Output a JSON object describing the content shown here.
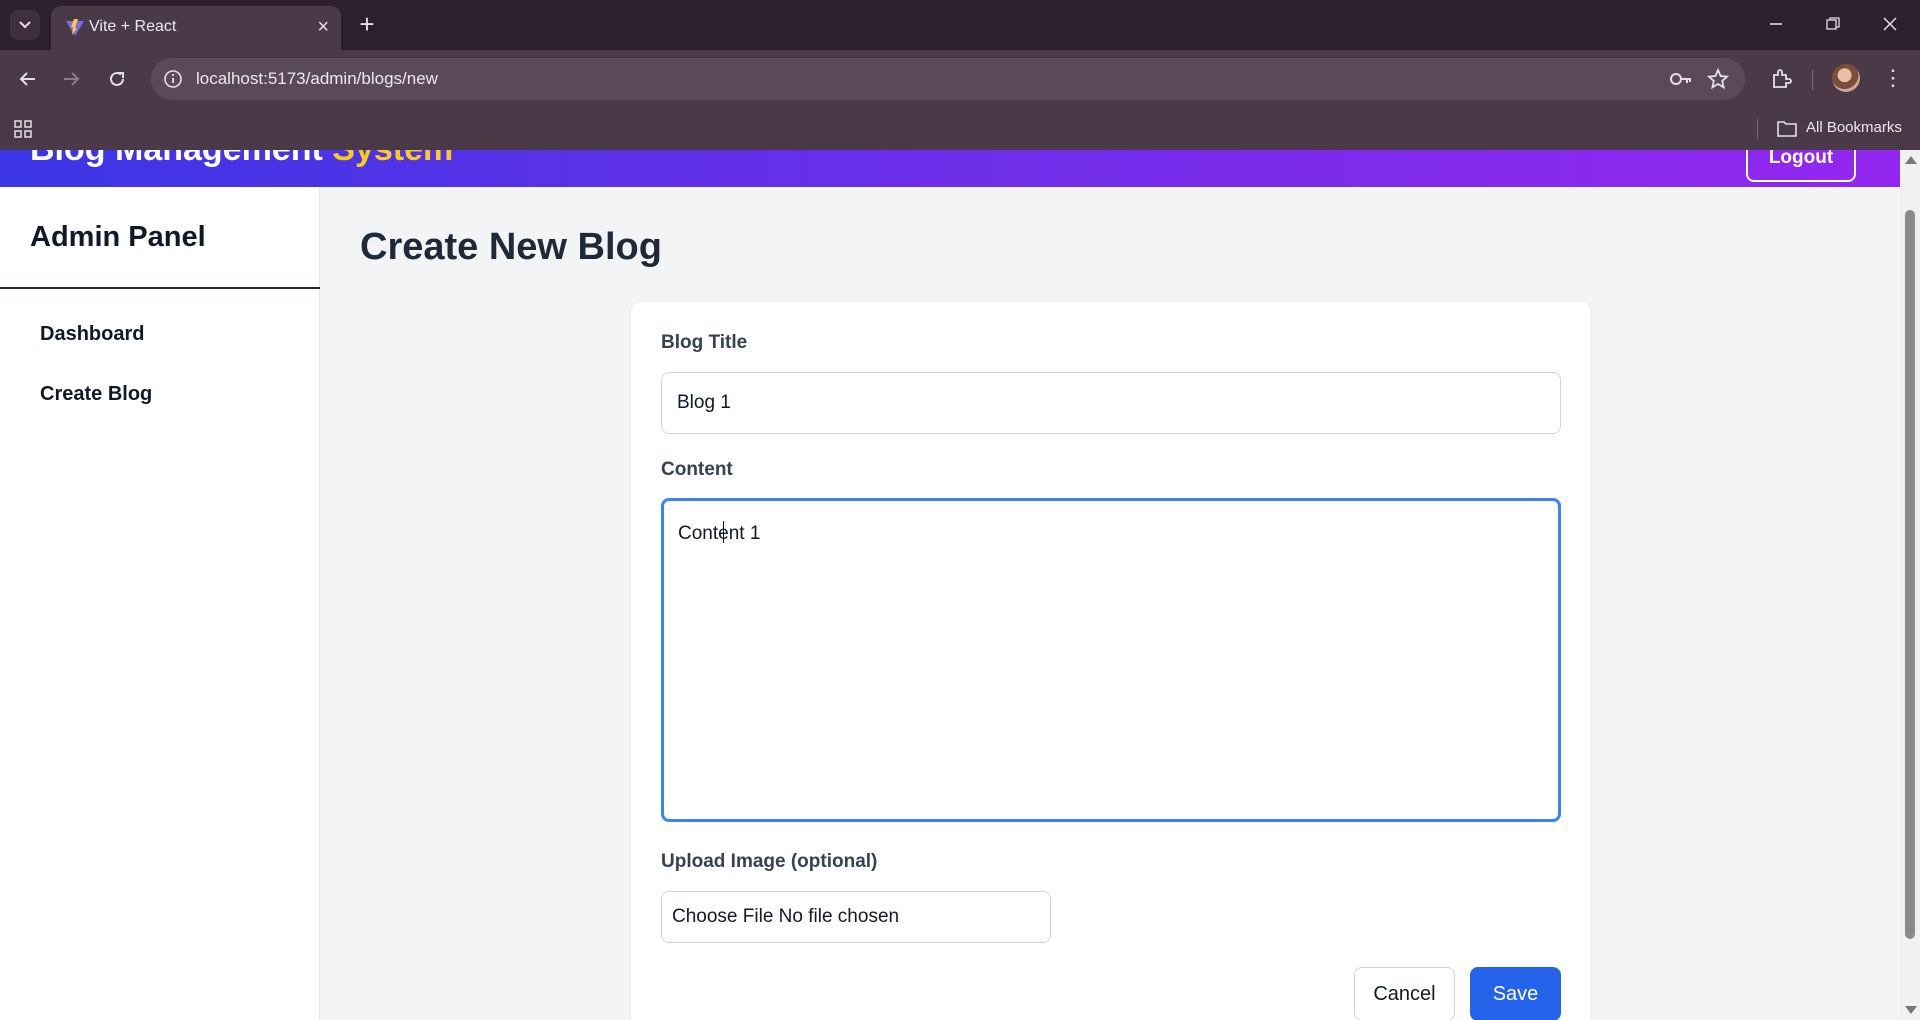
{
  "browser": {
    "tab_title": "Vite + React",
    "url": "localhost:5173/admin/blogs/new",
    "bookmarks_label": "All Bookmarks",
    "icons": [
      "tab-search-icon",
      "vite-favicon-icon",
      "close-icon",
      "new-tab-icon",
      "minimize-icon",
      "restore-icon",
      "close-window-icon",
      "back-icon",
      "forward-icon",
      "reload-icon",
      "site-info-icon",
      "password-key-icon",
      "bookmark-star-icon",
      "extensions-icon",
      "profile-avatar",
      "menu-icon",
      "apps-icon",
      "folder-icon"
    ]
  },
  "header": {
    "brand_main": "Blog Management",
    "brand_accent": "System",
    "logout_label": "Logout",
    "brand_accent_color": "#facc15"
  },
  "sidebar": {
    "title": "Admin Panel",
    "items": [
      {
        "label": "Dashboard"
      },
      {
        "label": "Create Blog"
      }
    ]
  },
  "main": {
    "title": "Create New Blog",
    "form": {
      "title_label": "Blog Title",
      "title_value": "Blog 1",
      "content_label": "Content",
      "content_before_caret": "Conte",
      "content_after_caret": "nt 1",
      "image_label": "Upload Image (optional)",
      "file_button": "Choose File",
      "file_status": "No file chosen",
      "cancel_label": "Cancel",
      "save_label": "Save"
    }
  },
  "colors": {
    "primary": "#2563eb",
    "focus_ring": "#3b82f6",
    "header_gradient_start": "#3b36e6",
    "header_gradient_end": "#9327f0"
  }
}
